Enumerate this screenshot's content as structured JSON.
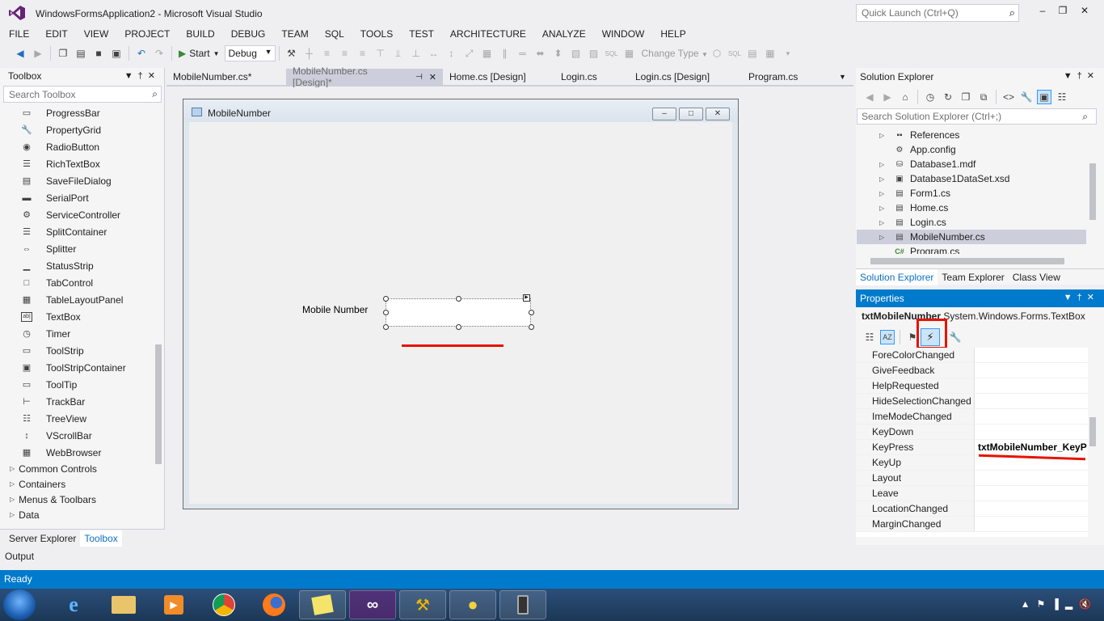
{
  "window": {
    "title": "WindowsFormsApplication2 - Microsoft Visual Studio",
    "quick_launch_placeholder": "Quick Launch (Ctrl+Q)"
  },
  "menu": [
    "FILE",
    "EDIT",
    "VIEW",
    "PROJECT",
    "BUILD",
    "DEBUG",
    "TEAM",
    "SQL",
    "TOOLS",
    "TEST",
    "ARCHITECTURE",
    "ANALYZE",
    "WINDOW",
    "HELP"
  ],
  "toolbar": {
    "start_label": "Start",
    "configuration": "Debug",
    "change_type_label": "Change Type"
  },
  "toolbox": {
    "title": "Toolbox",
    "search_placeholder": "Search Toolbox",
    "items": [
      {
        "label": "ProgressBar",
        "icon": "progressbar-icon"
      },
      {
        "label": "PropertyGrid",
        "icon": "propertygrid-icon"
      },
      {
        "label": "RadioButton",
        "icon": "radiobutton-icon"
      },
      {
        "label": "RichTextBox",
        "icon": "richtextbox-icon"
      },
      {
        "label": "SaveFileDialog",
        "icon": "savefiledialog-icon"
      },
      {
        "label": "SerialPort",
        "icon": "serialport-icon"
      },
      {
        "label": "ServiceController",
        "icon": "servicecontroller-icon"
      },
      {
        "label": "SplitContainer",
        "icon": "splitcontainer-icon"
      },
      {
        "label": "Splitter",
        "icon": "splitter-icon"
      },
      {
        "label": "StatusStrip",
        "icon": "statusstrip-icon"
      },
      {
        "label": "TabControl",
        "icon": "tabcontrol-icon"
      },
      {
        "label": "TableLayoutPanel",
        "icon": "tablelayoutpanel-icon"
      },
      {
        "label": "TextBox",
        "icon": "textbox-icon"
      },
      {
        "label": "Timer",
        "icon": "timer-icon"
      },
      {
        "label": "ToolStrip",
        "icon": "toolstrip-icon"
      },
      {
        "label": "ToolStripContainer",
        "icon": "toolstripcontainer-icon"
      },
      {
        "label": "ToolTip",
        "icon": "tooltip-icon"
      },
      {
        "label": "TrackBar",
        "icon": "trackbar-icon"
      },
      {
        "label": "TreeView",
        "icon": "treeview-icon"
      },
      {
        "label": "VScrollBar",
        "icon": "vscrollbar-icon"
      },
      {
        "label": "WebBrowser",
        "icon": "webbrowser-icon"
      }
    ],
    "groups": [
      "Common Controls",
      "Containers",
      "Menus & Toolbars",
      "Data"
    ],
    "bottom_tabs": [
      "Server Explorer",
      "Toolbox"
    ]
  },
  "doc_tabs": [
    {
      "label": "MobileNumber.cs*",
      "active": false
    },
    {
      "label": "MobileNumber.cs [Design]*",
      "active": true
    },
    {
      "label": "Home.cs [Design]",
      "active": false
    },
    {
      "label": "Login.cs",
      "active": false
    },
    {
      "label": "Login.cs [Design]",
      "active": false
    },
    {
      "label": "Program.cs",
      "active": false
    }
  ],
  "form": {
    "title": "MobileNumber",
    "label_text": "Mobile Number"
  },
  "solution_explorer": {
    "title": "Solution Explorer",
    "search_placeholder": "Search Solution Explorer (Ctrl+;)",
    "items": [
      {
        "label": "References",
        "icon": "references-icon",
        "expandable": true,
        "selected": false
      },
      {
        "label": "App.config",
        "icon": "config-file-icon",
        "expandable": false,
        "selected": false
      },
      {
        "label": "Database1.mdf",
        "icon": "database-icon",
        "expandable": true,
        "selected": false
      },
      {
        "label": "Database1DataSet.xsd",
        "icon": "dataset-icon",
        "expandable": true,
        "selected": false
      },
      {
        "label": "Form1.cs",
        "icon": "form-icon",
        "expandable": true,
        "selected": false
      },
      {
        "label": "Home.cs",
        "icon": "form-icon",
        "expandable": true,
        "selected": false
      },
      {
        "label": "Login.cs",
        "icon": "form-icon",
        "expandable": true,
        "selected": false
      },
      {
        "label": "MobileNumber.cs",
        "icon": "form-icon",
        "expandable": true,
        "selected": true
      },
      {
        "label": "Program.cs",
        "icon": "csharp-file-icon",
        "expandable": false,
        "selected": false
      }
    ],
    "tabs": [
      "Solution Explorer",
      "Team Explorer",
      "Class View"
    ]
  },
  "properties": {
    "title": "Properties",
    "object_name": "txtMobileNumber",
    "object_type": "System.Windows.Forms.TextBox",
    "rows": [
      {
        "name": "ForeColorChanged",
        "value": ""
      },
      {
        "name": "GiveFeedback",
        "value": ""
      },
      {
        "name": "HelpRequested",
        "value": ""
      },
      {
        "name": "HideSelectionChanged",
        "value": ""
      },
      {
        "name": "ImeModeChanged",
        "value": ""
      },
      {
        "name": "KeyDown",
        "value": ""
      },
      {
        "name": "KeyPress",
        "value": "txtMobileNumber_KeyP"
      },
      {
        "name": "KeyUp",
        "value": ""
      },
      {
        "name": "Layout",
        "value": ""
      },
      {
        "name": "Leave",
        "value": ""
      },
      {
        "name": "LocationChanged",
        "value": ""
      },
      {
        "name": "MarginChanged",
        "value": ""
      }
    ]
  },
  "output_label": "Output",
  "status_text": "Ready",
  "colors": {
    "accent": "#007acc",
    "highlight_red": "#e51400",
    "selection": "#cccedb"
  }
}
